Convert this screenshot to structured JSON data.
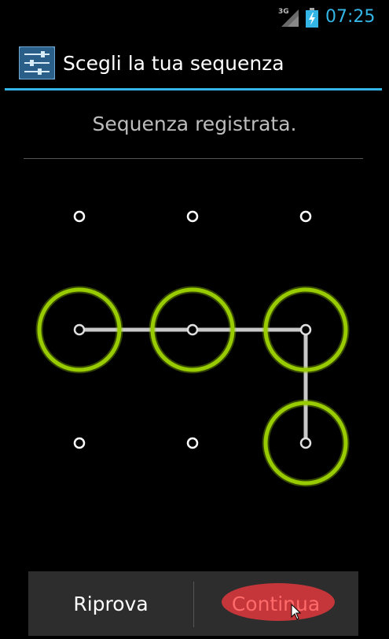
{
  "status_bar": {
    "network": "3G",
    "time": "07:25",
    "icons": [
      "signal-icon",
      "battery-charging-icon"
    ]
  },
  "action_bar": {
    "title": "Scegli la tua sequenza",
    "icon": "settings-icon"
  },
  "header": {
    "message": "Sequenza registrata."
  },
  "pattern": {
    "grid_size": 3,
    "selected_dots": [
      [
        1,
        0
      ],
      [
        1,
        1
      ],
      [
        1,
        2
      ],
      [
        2,
        2
      ]
    ],
    "ring_color": "#99cc00",
    "line_color": "#c8c8c8"
  },
  "buttons": {
    "retry_label": "Riprova",
    "continue_label": "Continua"
  },
  "colors": {
    "accent": "#33b5e5",
    "highlight": "#d9383c"
  }
}
